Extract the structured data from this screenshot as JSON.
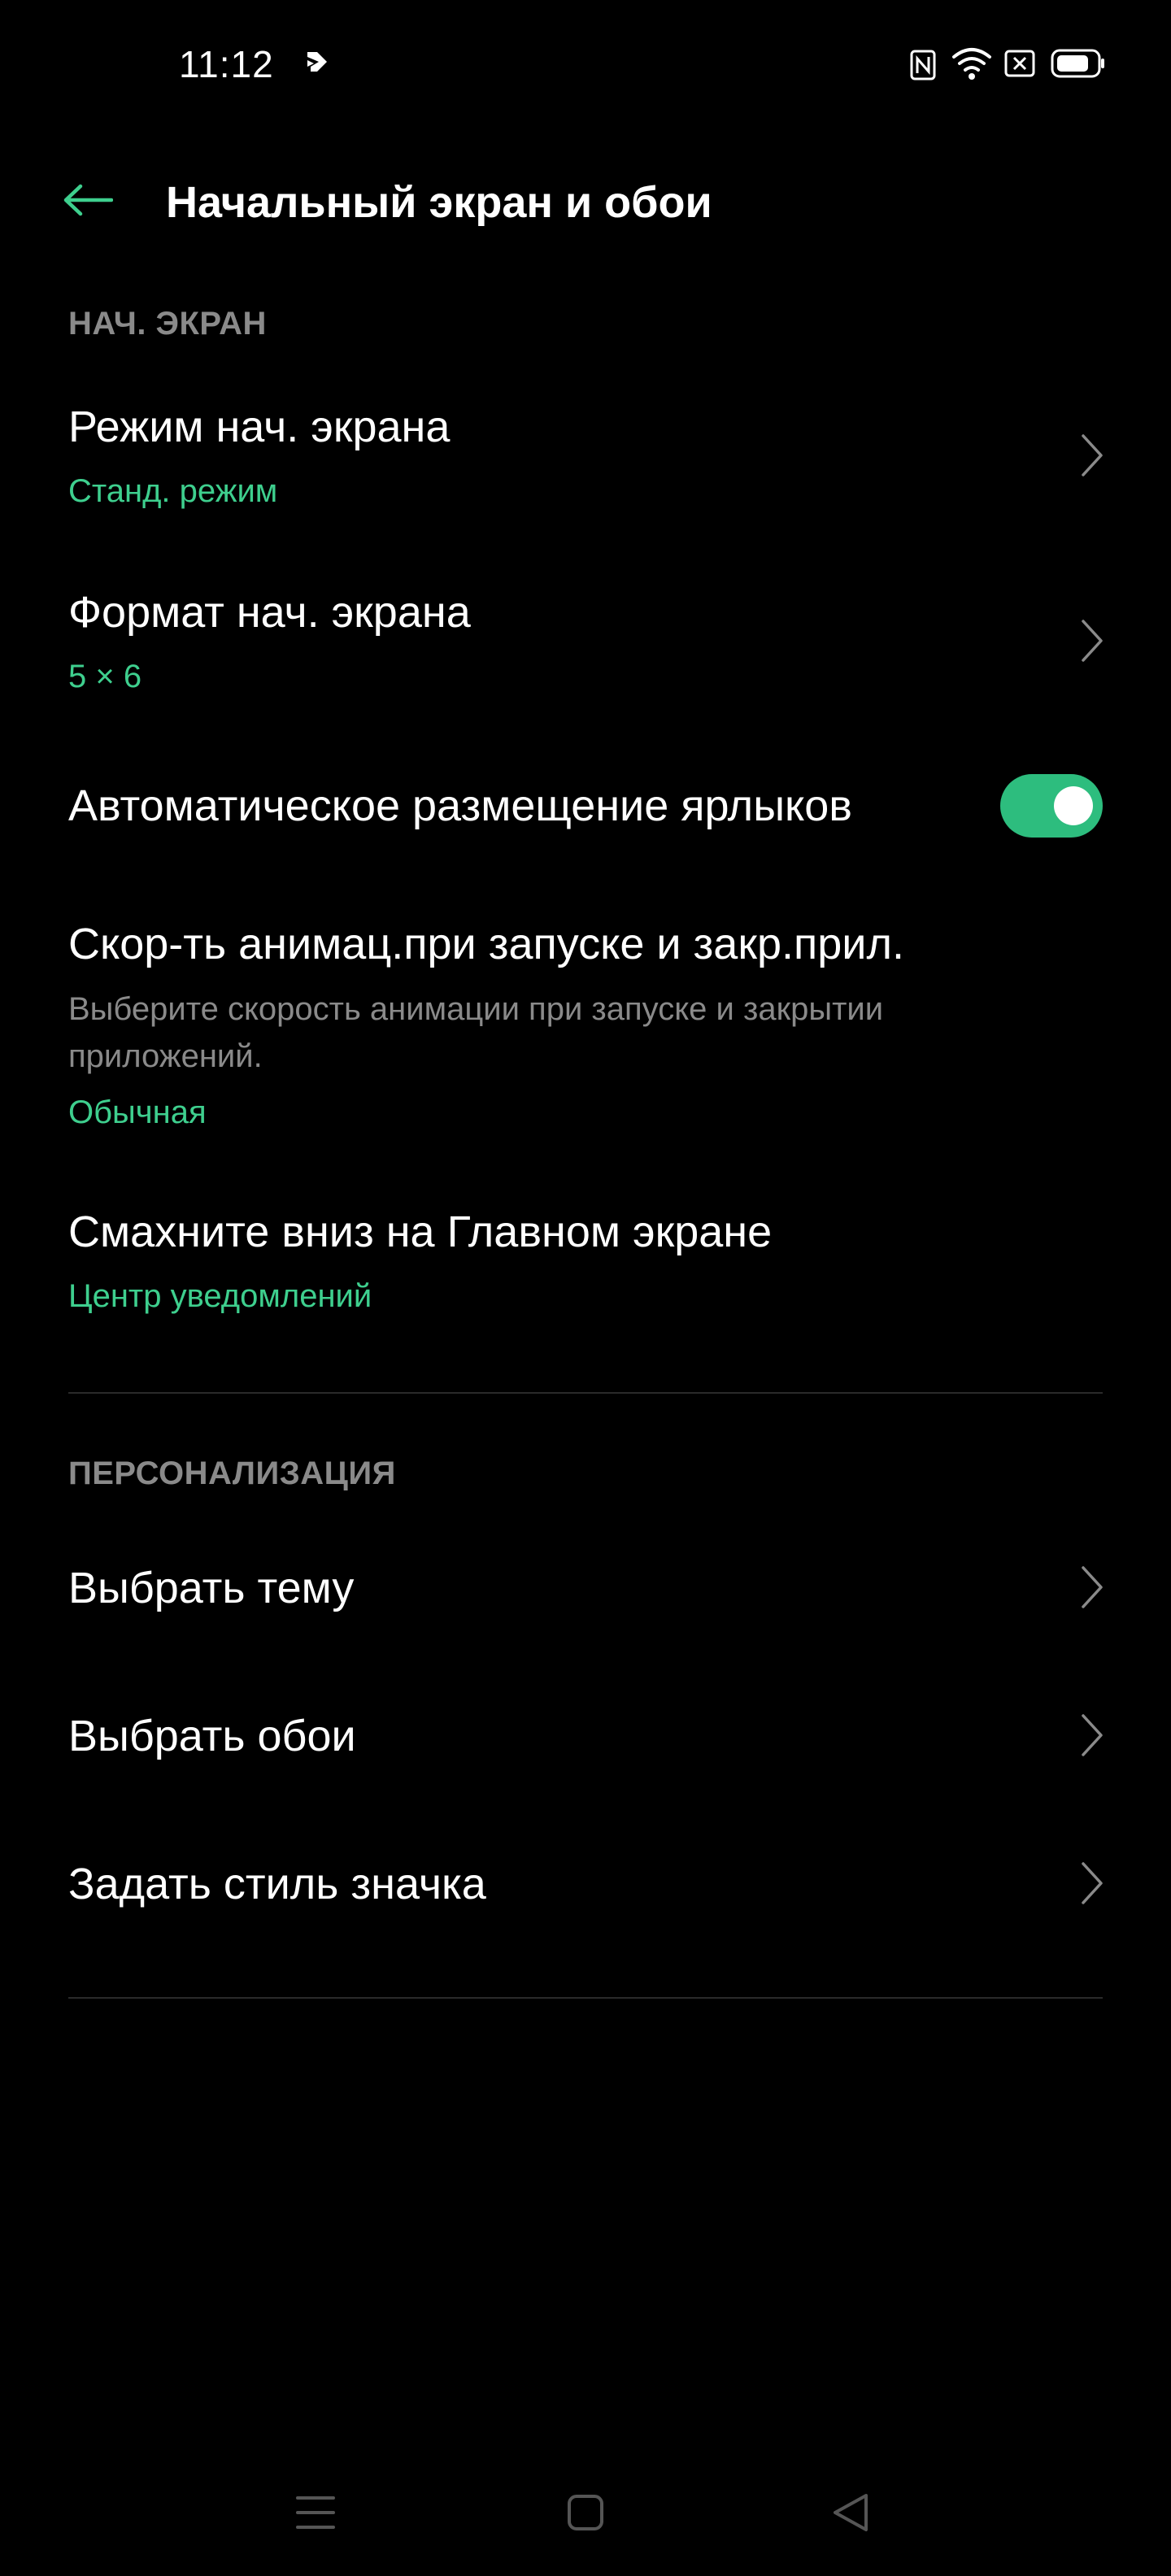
{
  "status_bar": {
    "time": "11:12",
    "icons": [
      "app-notification-icon",
      "nfc-icon",
      "wifi-icon",
      "sim-no-signal-icon",
      "battery-icon"
    ]
  },
  "header": {
    "title": "Начальный экран и обои",
    "back_icon": "arrow-left-icon"
  },
  "sections": {
    "home_screen": {
      "header": "НАЧ. ЭКРАН",
      "items": [
        {
          "title": "Режим нач. экрана",
          "value": "Станд. режим"
        },
        {
          "title": "Формат нач. экрана",
          "value": "5 × 6"
        },
        {
          "title": "Автоматическое размещение ярлыков",
          "toggle_on": true
        },
        {
          "title": "Скор-ть анимац.при запуске и закр.прил.",
          "description": "Выберите скорость анимации при запуске и закрытии приложений.",
          "value": "Обычная"
        },
        {
          "title": "Смахните вниз на Главном экране",
          "value": "Центр уведомлений"
        }
      ]
    },
    "personalization": {
      "header": "ПЕРСОНАЛИЗАЦИЯ",
      "items": [
        {
          "title": "Выбрать тему"
        },
        {
          "title": "Выбрать обои"
        },
        {
          "title": "Задать стиль значка"
        }
      ]
    }
  },
  "nav_bar": {
    "icons": [
      "menu-icon",
      "home-icon",
      "back-triangle-icon"
    ]
  },
  "colors": {
    "accent": "#3ecf8e",
    "toggle_on": "#2dbd7e",
    "background": "#000000",
    "secondary_text": "#8a8a8a"
  }
}
